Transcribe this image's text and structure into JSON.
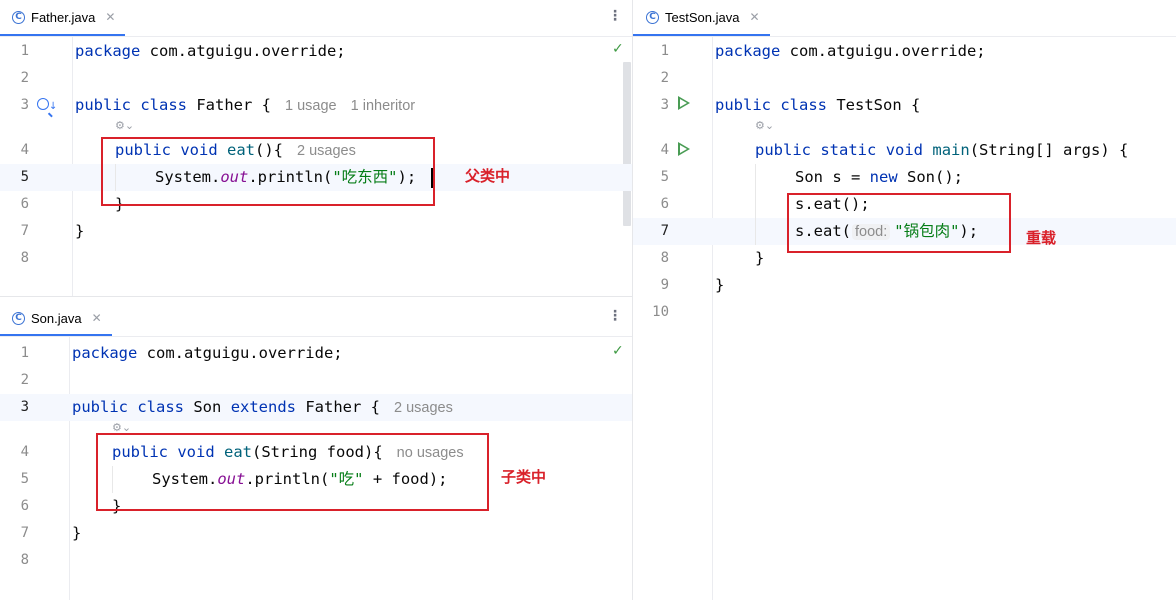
{
  "panes": {
    "father": {
      "tab": {
        "label": "Father.java",
        "icon": "class-c-icon"
      },
      "lines": [
        {
          "n": "1"
        },
        {
          "n": "2"
        },
        {
          "n": "3"
        },
        {
          "n": "4"
        },
        {
          "n": "5"
        },
        {
          "n": "6"
        },
        {
          "n": "7"
        },
        {
          "n": "8"
        }
      ],
      "code": {
        "l1_kw": "package",
        "l1_rest": " com.atguigu.override;",
        "l3_kw1": "public",
        "l3_kw2": "class",
        "l3_rest": " Father {",
        "l3_hint1": "1 usage",
        "l3_hint2": "1 inheritor",
        "l4_kw1": "public",
        "l4_kw2": "void",
        "l4_fn": "eat",
        "l4_rest": "(){",
        "l4_hint": "2 usages",
        "l5_a": "System.",
        "l5_field": "out",
        "l5_b": ".println(",
        "l5_str": "\"吃东西\"",
        "l5_c": ");",
        "l6": "}",
        "l7": "}"
      },
      "annotation": "父类中"
    },
    "son": {
      "tab": {
        "label": "Son.java",
        "icon": "class-c-icon"
      },
      "lines": [
        {
          "n": "1"
        },
        {
          "n": "2"
        },
        {
          "n": "3"
        },
        {
          "n": "4"
        },
        {
          "n": "5"
        },
        {
          "n": "6"
        },
        {
          "n": "7"
        },
        {
          "n": "8"
        }
      ],
      "code": {
        "l1_kw": "package",
        "l1_rest": " com.atguigu.override;",
        "l3_kw1": "public",
        "l3_kw2": "class",
        "l3_mid": " Son ",
        "l3_kw3": "extends",
        "l3_rest": " Father {",
        "l3_hint": "2 usages",
        "l4_kw1": "public",
        "l4_kw2": "void",
        "l4_fn": "eat",
        "l4_rest": "(String food){",
        "l4_hint": "no usages",
        "l5_a": "System.",
        "l5_field": "out",
        "l5_b": ".println(",
        "l5_str": "\"吃\"",
        "l5_c": " + food);",
        "l6": "}",
        "l7": "}"
      },
      "annotation": "子类中"
    },
    "testson": {
      "tab": {
        "label": "TestSon.java",
        "icon": "class-c-icon"
      },
      "lines": [
        {
          "n": "1"
        },
        {
          "n": "2"
        },
        {
          "n": "3"
        },
        {
          "n": "4"
        },
        {
          "n": "5"
        },
        {
          "n": "6"
        },
        {
          "n": "7"
        },
        {
          "n": "8"
        },
        {
          "n": "9"
        },
        {
          "n": "10"
        }
      ],
      "code": {
        "l1_kw": "package",
        "l1_rest": " com.atguigu.override;",
        "l3_kw1": "public",
        "l3_kw2": "class",
        "l3_rest": " TestSon {",
        "l4_kw1": "public",
        "l4_kw2": "static",
        "l4_kw3": "void",
        "l4_fn": "main",
        "l4_rest": "(String[] args) {",
        "l5_a": "Son s = ",
        "l5_kw": "new",
        "l5_b": " Son();",
        "l6": "s.eat();",
        "l7_a": "s.eat(",
        "l7_inlay": "food:",
        "l7_str": "\"锅包肉\"",
        "l7_b": ");",
        "l8": "}",
        "l9": "}"
      },
      "annotation": "重载"
    }
  }
}
